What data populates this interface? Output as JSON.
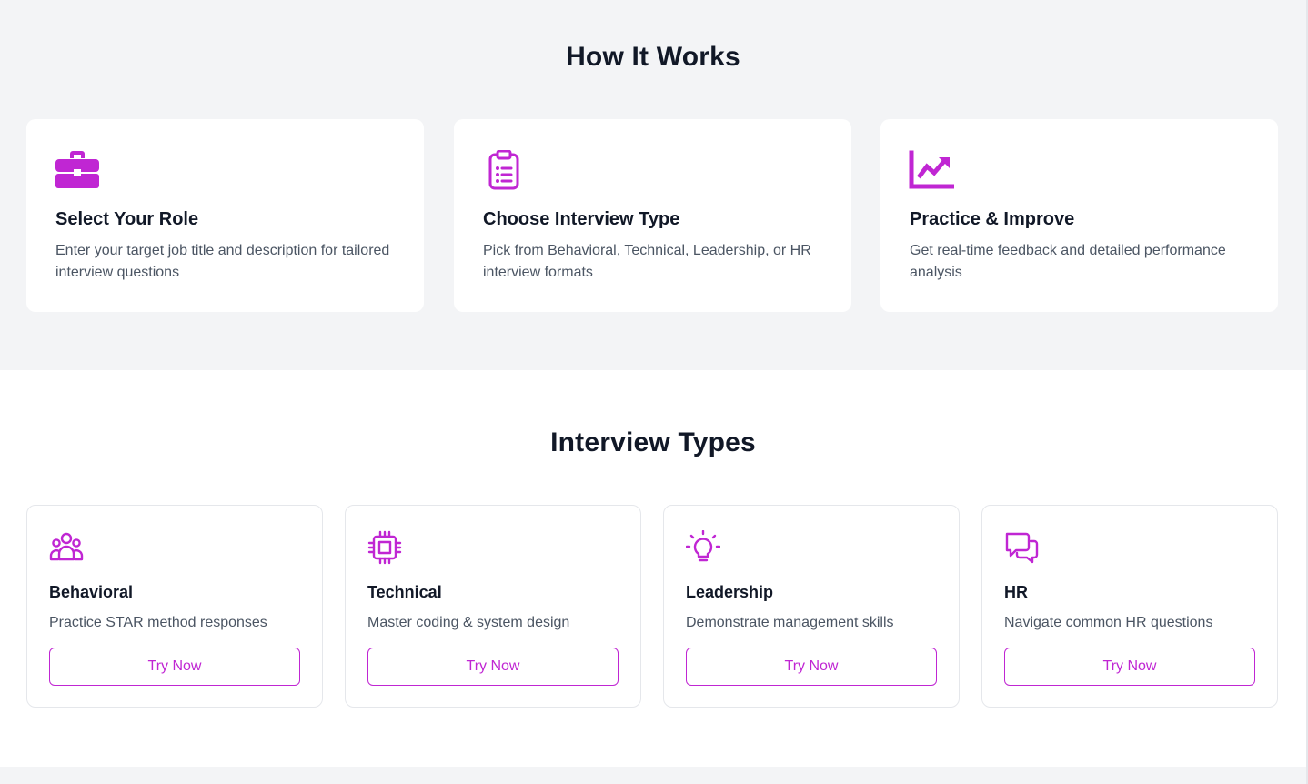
{
  "how_it_works": {
    "title": "How It Works",
    "steps": [
      {
        "icon": "briefcase-icon",
        "title": "Select Your Role",
        "description": "Enter your target job title and description for tailored interview questions"
      },
      {
        "icon": "clipboard-list-icon",
        "title": "Choose Interview Type",
        "description": "Pick from Behavioral, Technical, Leadership, or HR interview formats"
      },
      {
        "icon": "chart-trend-icon",
        "title": "Practice & Improve",
        "description": "Get real-time feedback and detailed performance analysis"
      }
    ]
  },
  "interview_types": {
    "title": "Interview Types",
    "items": [
      {
        "icon": "users-group-icon",
        "title": "Behavioral",
        "description": "Practice STAR method responses",
        "button": "Try Now"
      },
      {
        "icon": "cpu-chip-icon",
        "title": "Technical",
        "description": "Master coding & system design",
        "button": "Try Now"
      },
      {
        "icon": "lightbulb-icon",
        "title": "Leadership",
        "description": "Demonstrate management skills",
        "button": "Try Now"
      },
      {
        "icon": "chat-bubbles-icon",
        "title": "HR",
        "description": "Navigate common HR questions",
        "button": "Try Now"
      }
    ]
  },
  "colors": {
    "accent": "#c026d3",
    "section_background": "#f3f4f6",
    "heading": "#111827",
    "body_text": "#4b5563"
  }
}
